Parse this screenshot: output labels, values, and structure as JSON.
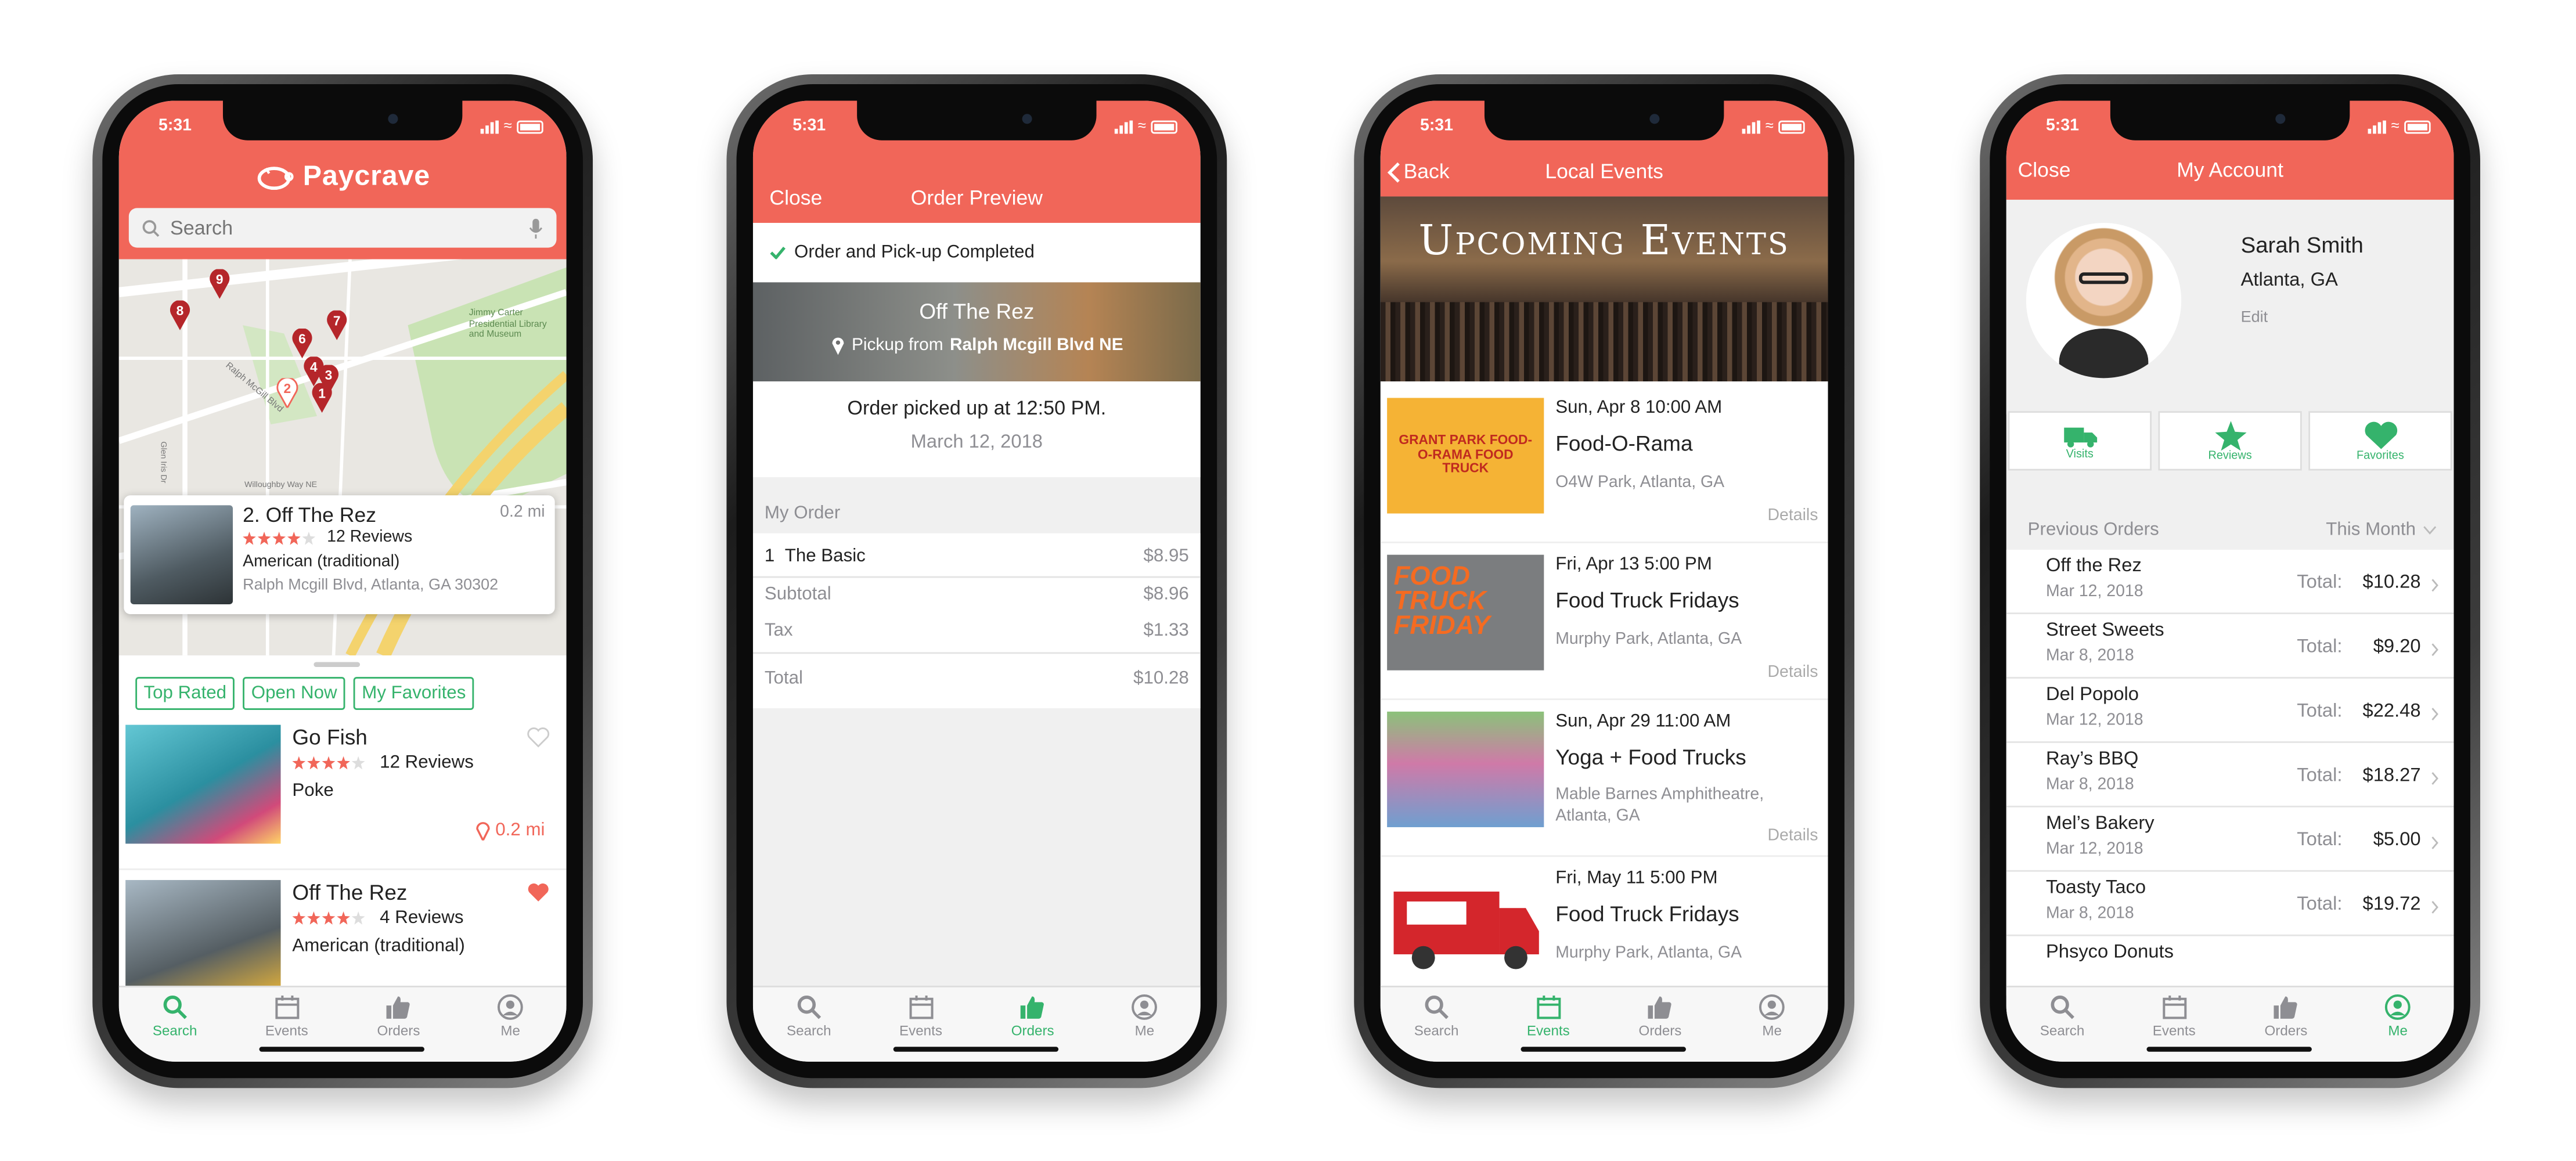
{
  "status_time": "5:31",
  "tabs": [
    "Search",
    "Events",
    "Orders",
    "Me"
  ],
  "colors": {
    "brand": "#f16659",
    "accent": "#35b36c",
    "muted": "#8e8e93"
  },
  "search_screen": {
    "brand": "Paycrave",
    "search_placeholder": "Search",
    "map_pins": [
      "9",
      "8",
      "7",
      "6",
      "4",
      "3",
      "2",
      "1"
    ],
    "map_labels": [
      "Jimmy Carter Presidential Library and Museum",
      "Ralph McGill Blvd",
      "Willoughby Way NE",
      "Glen Iris Dr"
    ],
    "featured": {
      "title": "2. Off The Rez",
      "distance": "0.2 mi",
      "reviews": "12 Reviews",
      "cuisine": "American (traditional)",
      "address": "Ralph Mcgill Blvd, Atlanta, GA 30302"
    },
    "filters": [
      "Top Rated",
      "Open Now",
      "My Favorites"
    ],
    "listings": [
      {
        "name": "Go Fish",
        "reviews": "12 Reviews",
        "cuisine": "Poke",
        "distance": "0.2 mi"
      },
      {
        "name": "Off The Rez",
        "reviews": "4 Reviews",
        "cuisine": "American (traditional)",
        "distance": ""
      }
    ]
  },
  "order_screen": {
    "close": "Close",
    "title": "Order Preview",
    "completed": "Order and Pick-up Completed",
    "vendor": "Off The Rez",
    "pickup_prefix": "Pickup from",
    "pickup_place": "Ralph Mcgill Blvd NE",
    "picked_up": "Order picked up at 12:50 PM.",
    "date": "March 12, 2018",
    "section": "My Order",
    "item_qty": "1",
    "item_name": "The Basic",
    "item_price": "$8.95",
    "subtotal_label": "Subtotal",
    "subtotal": "$8.96",
    "tax_label": "Tax",
    "tax": "$1.33",
    "total_label": "Total",
    "total": "$10.28"
  },
  "events_screen": {
    "back": "Back",
    "title": "Local Events",
    "hero": "Upcoming Events",
    "details": "Details",
    "events": [
      {
        "date": "Sun, Apr 8 10:00 AM",
        "name": "Food-O-Rama",
        "place": "O4W Park, Atlanta, GA",
        "thumb": "GRANT PARK FOOD-O-RAMA FOOD TRUCK"
      },
      {
        "date": "Fri, Apr 13 5:00 PM",
        "name": "Food Truck Fridays",
        "place": "Murphy Park, Atlanta, GA",
        "thumb": "FOOD TRUCK FRIDAY"
      },
      {
        "date": "Sun, Apr 29 11:00 AM",
        "name": "Yoga + Food Trucks",
        "place": "Mable Barnes Amphitheatre, Atlanta, GA",
        "thumb": ""
      },
      {
        "date": "Fri, May 11 5:00 PM",
        "name": "Food Truck Fridays",
        "place": "Murphy Park, Atlanta, GA",
        "thumb": ""
      }
    ]
  },
  "account_screen": {
    "close": "Close",
    "title": "My Account",
    "name": "Sarah Smith",
    "location": "Atlanta, GA",
    "edit": "Edit",
    "quick": [
      "Visits",
      "Reviews",
      "Favorites"
    ],
    "prev_orders": "Previous Orders",
    "period": "This Month",
    "total_label": "Total:",
    "orders": [
      {
        "name": "Off the Rez",
        "date": "Mar 12, 2018",
        "total": "$10.28"
      },
      {
        "name": "Street Sweets",
        "date": "Mar 8, 2018",
        "total": "$9.20"
      },
      {
        "name": "Del Popolo",
        "date": "Mar 12, 2018",
        "total": "$22.48"
      },
      {
        "name": "Ray’s BBQ",
        "date": "Mar 8, 2018",
        "total": "$18.27"
      },
      {
        "name": "Mel’s Bakery",
        "date": "Mar 12, 2018",
        "total": "$5.00"
      },
      {
        "name": "Toasty Taco",
        "date": "Mar 8, 2018",
        "total": "$19.72"
      },
      {
        "name": "Phsyco Donuts",
        "date": "",
        "total": ""
      }
    ]
  }
}
